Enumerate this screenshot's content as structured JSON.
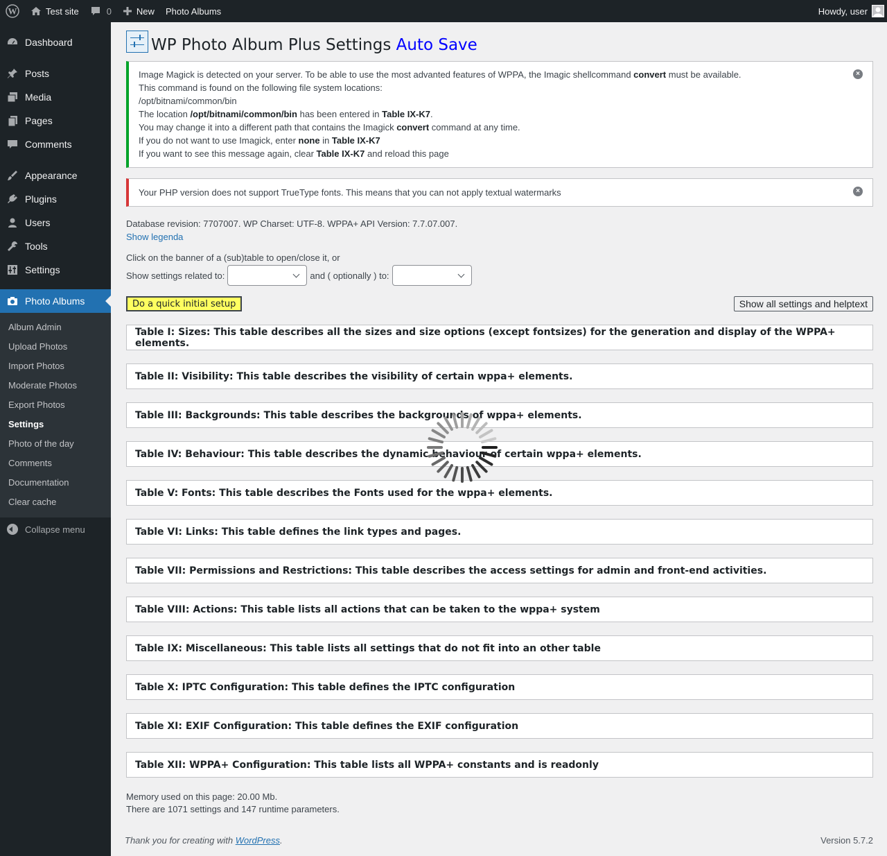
{
  "adminbar": {
    "site_name": "Test site",
    "comments_count": "0",
    "new_label": "New",
    "photo_albums_label": "Photo Albums",
    "greeting": "Howdy, user"
  },
  "sidebar": {
    "items": [
      {
        "label": "Dashboard",
        "icon": "dashboard-icon"
      },
      {
        "label": "Posts",
        "icon": "pin-icon"
      },
      {
        "label": "Media",
        "icon": "media-icon"
      },
      {
        "label": "Pages",
        "icon": "pages-icon"
      },
      {
        "label": "Comments",
        "icon": "comment-icon"
      },
      {
        "label": "Appearance",
        "icon": "brush-icon"
      },
      {
        "label": "Plugins",
        "icon": "plugin-icon"
      },
      {
        "label": "Users",
        "icon": "user-icon"
      },
      {
        "label": "Tools",
        "icon": "wrench-icon"
      },
      {
        "label": "Settings",
        "icon": "sliders-icon"
      },
      {
        "label": "Photo Albums",
        "icon": "camera-icon"
      }
    ],
    "submenu": [
      "Album Admin",
      "Upload Photos",
      "Import Photos",
      "Moderate Photos",
      "Export Photos",
      "Settings",
      "Photo of the day",
      "Comments",
      "Documentation",
      "Clear cache"
    ],
    "collapse_label": "Collapse menu"
  },
  "page": {
    "title": "WP Photo Album Plus Settings",
    "autosave": "Auto Save"
  },
  "notice_imagick": {
    "l1_a": "Image Magick is detected on your server. To be able to use the most advanted features of WPPA, the Imagic shellcommand ",
    "l1_b": "convert",
    "l1_c": " must be available.",
    "l2": "This command is found on the following file system locations:",
    "l3": "/opt/bitnami/common/bin",
    "l4_a": "The location ",
    "l4_b": "/opt/bitnami/common/bin",
    "l4_c": " has been entered in ",
    "l4_d": "Table IX-K7",
    "l4_e": ".",
    "l5_a": "You may change it into a different path that contains the Imagick ",
    "l5_b": "convert",
    "l5_c": " command at any time.",
    "l6_a": "If you do not want to use Imagick, enter ",
    "l6_b": "none",
    "l6_c": " in ",
    "l6_d": "Table IX-K7",
    "l7_a": "If you want to see this message again, clear ",
    "l7_b": "Table IX-K7",
    "l7_c": " and reload this page"
  },
  "notice_php": "Your PHP version does not support TrueType fonts. This means that you can not apply textual watermarks",
  "dbinfo": "Database revision: 7707007. WP Charset: UTF-8. WPPA+ API Version: 7.7.07.007.",
  "show_legenda": "Show legenda",
  "filter": {
    "intro": "Click on the banner of a (sub)table to open/close it, or",
    "label1": "Show settings related to:",
    "label2": "and ( optionally ) to:",
    "select1": "",
    "select2": ""
  },
  "buttons": {
    "setup": "Do a quick initial setup",
    "show_all": "Show all settings and helptext"
  },
  "tables": [
    "Table I: Sizes: This table describes all the sizes and size options (except fontsizes) for the generation and display of the WPPA+ elements.",
    "Table II: Visibility: This table describes the visibility of certain wppa+ elements.",
    "Table III: Backgrounds: This table describes the backgrounds of wppa+ elements.",
    "Table IV: Behaviour: This table describes the dynamic behaviour of certain wppa+ elements.",
    "Table V: Fonts: This table describes the Fonts used for the wppa+ elements.",
    "Table VI: Links: This table defines the link types and pages.",
    "Table VII: Permissions and Restrictions: This table describes the access settings for admin and front-end activities.",
    "Table VIII: Actions: This table lists all actions that can be taken to the wppa+ system",
    "Table IX: Miscellaneous: This table lists all settings that do not fit into an other table",
    "Table X: IPTC Configuration: This table defines the IPTC configuration",
    "Table XI: EXIF Configuration: This table defines the EXIF configuration",
    "Table XII: WPPA+ Configuration: This table lists all WPPA+ constants and is readonly"
  ],
  "memory": "Memory used on this page: 20.00 Mb.",
  "settings_count": "There are 1071 settings and 147 runtime parameters.",
  "footer": {
    "thanks_a": "Thank you for creating with ",
    "thanks_link": "WordPress",
    "thanks_b": ".",
    "version": "Version 5.7.2"
  },
  "colors": {
    "accent": "#2271b1",
    "sidebar_bg": "#1d2327",
    "setup_button": "#ffff60",
    "notice_success": "#00a32a",
    "notice_error": "#d63638"
  }
}
